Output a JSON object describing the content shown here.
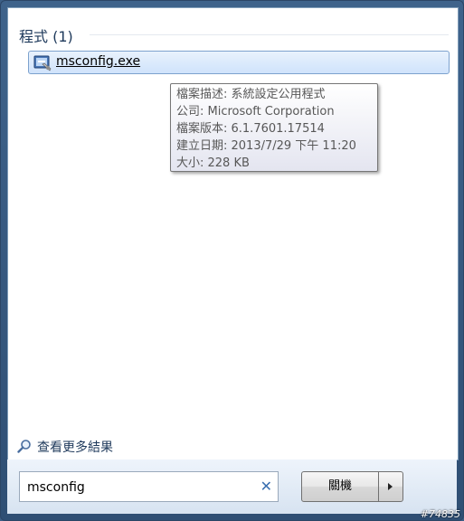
{
  "group": {
    "header": "程式 (1)"
  },
  "result": {
    "label": "msconfig.exe",
    "icon": "msconfig-app-icon"
  },
  "tooltip": {
    "lines": [
      "檔案描述: 系統設定公用程式",
      "公司: Microsoft Corporation",
      "檔案版本: 6.1.7601.17514",
      "建立日期: 2013/7/29 下午 11:20",
      "大小: 228 KB"
    ]
  },
  "more_results": {
    "label": "查看更多結果",
    "icon": "magnifier-icon"
  },
  "search": {
    "value": "msconfig",
    "clear_icon": "close-icon"
  },
  "shutdown": {
    "label": "關機",
    "arrow_icon": "arrow-right-icon"
  },
  "watermark": "#74835"
}
